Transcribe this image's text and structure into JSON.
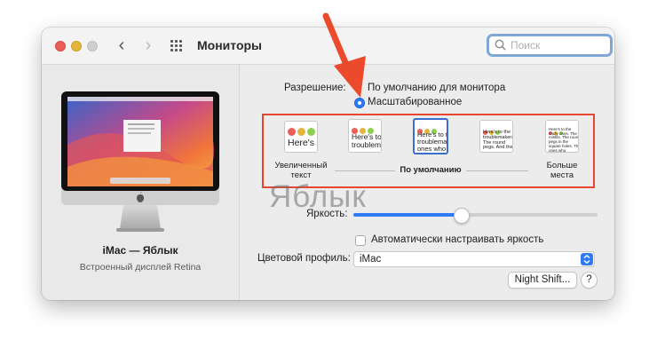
{
  "window": {
    "title": "Мониторы",
    "search_placeholder": "Поиск"
  },
  "display": {
    "name": "iMac — Яблык",
    "subtitle": "Встроенный дисплей Retina"
  },
  "resolution": {
    "label": "Разрешение:",
    "option_default": "По умолчанию для монитора",
    "option_scaled": "Масштабированное",
    "selected": "Масштабированное",
    "thumbs": [
      {
        "text": "Here's",
        "selected": false
      },
      {
        "text": "Here's to troublem",
        "selected": false
      },
      {
        "text": "Here's to the troublemak ones who",
        "selected": true
      },
      {
        "text": "Here's to the troublemakers. The round pegs. And they",
        "selected": false
      },
      {
        "text": "Here's to the crazy ones. The misfits. The round pegs in the square holes. The ones who",
        "selected": false
      }
    ],
    "label_larger": "Увеличенный текст",
    "label_default": "По умолчанию",
    "label_more": "Больше места"
  },
  "watermark": "Яблык",
  "brightness": {
    "label": "Яркость:",
    "value": 0.44
  },
  "auto_brightness": {
    "label": "Автоматически настраивать яркость",
    "checked": false
  },
  "color_profile": {
    "label": "Цветовой профиль:",
    "value": "iMac"
  },
  "buttons": {
    "night_shift": "Night Shift...",
    "help": "?"
  },
  "colors": {
    "accent": "#2f7bf6",
    "highlight_box": "#e8462e",
    "arrow": "#ec4a2c"
  }
}
